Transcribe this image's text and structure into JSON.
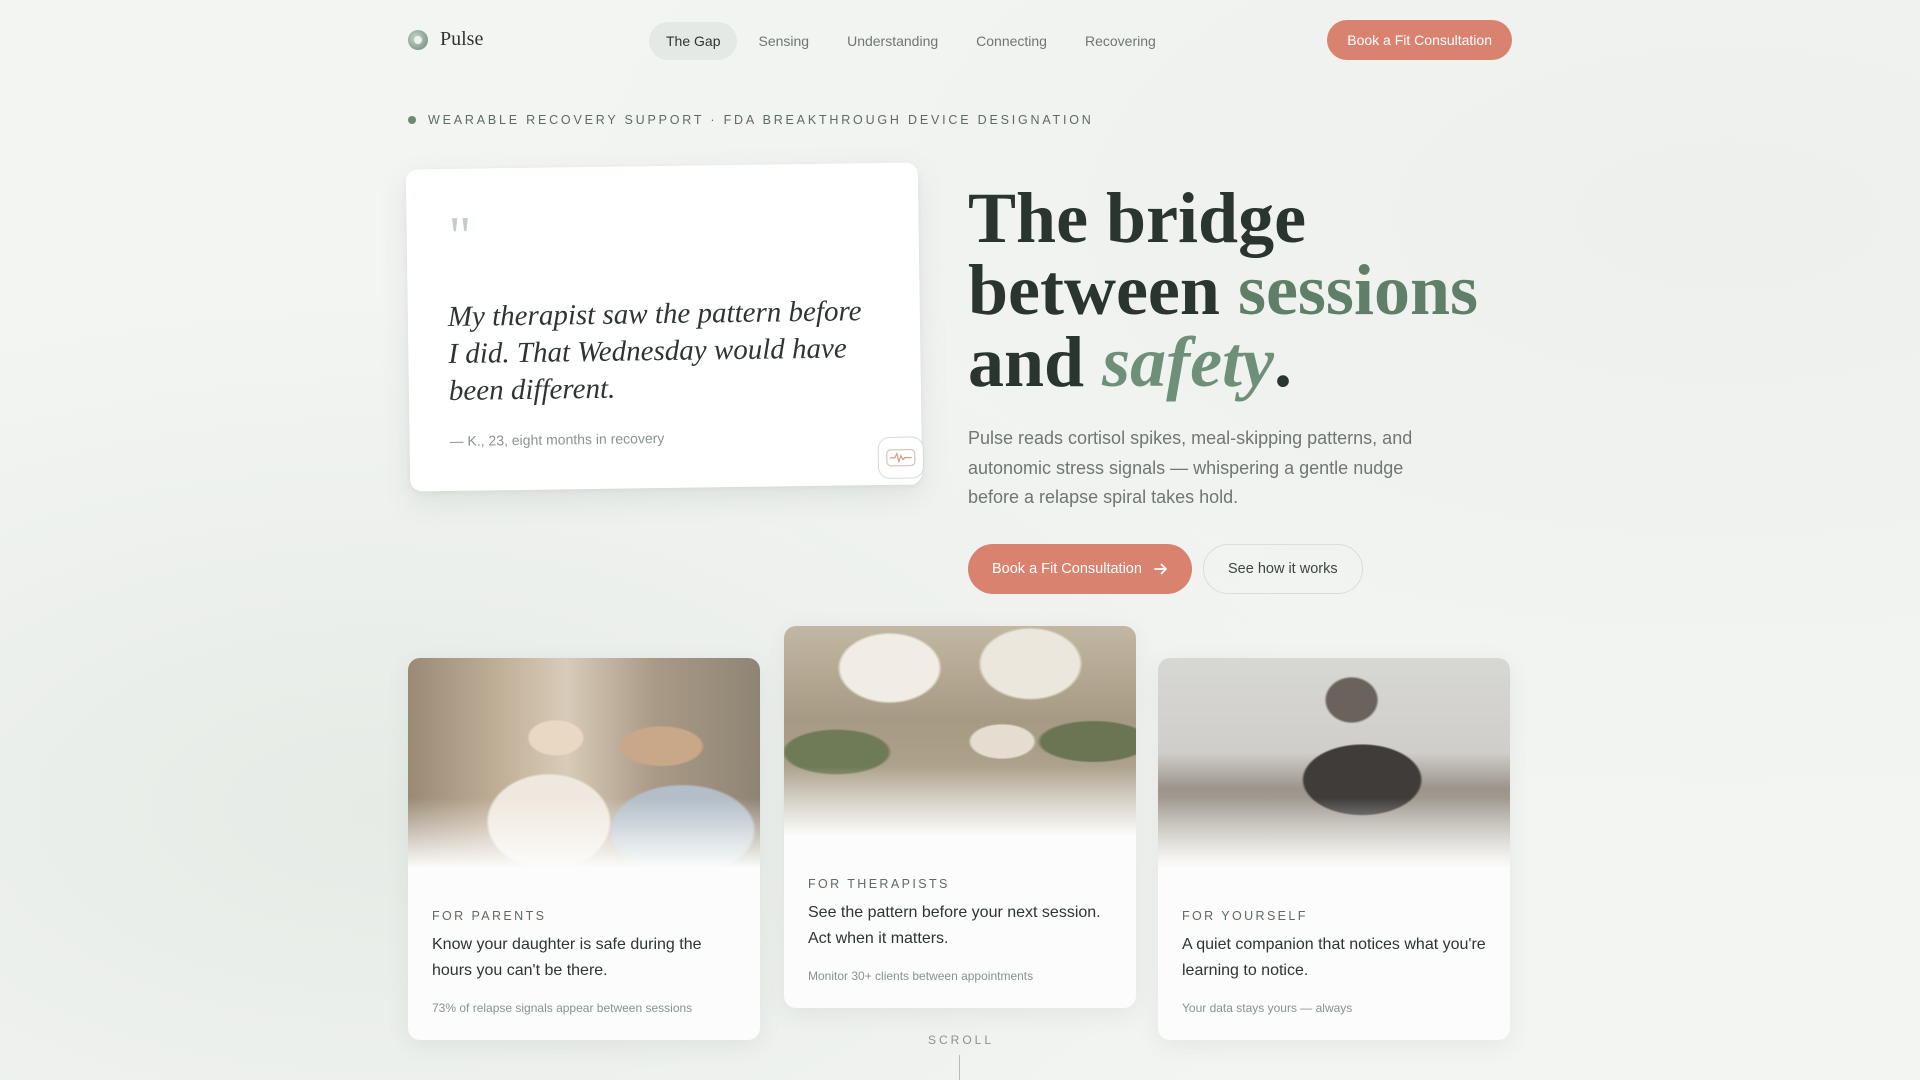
{
  "brand": {
    "name": "Pulse",
    "icon": "leaf-logo-icon"
  },
  "nav": {
    "items": [
      {
        "label": "The Gap",
        "active": true
      },
      {
        "label": "Sensing",
        "active": false
      },
      {
        "label": "Understanding",
        "active": false
      },
      {
        "label": "Connecting",
        "active": false
      },
      {
        "label": "Recovering",
        "active": false
      }
    ],
    "cta_label": "Book a Fit Consultation"
  },
  "eyebrow": "WEARABLE RECOVERY SUPPORT · FDA BREAKTHROUGH DEVICE DESIGNATION",
  "quote": {
    "mark": "\"",
    "text": "My therapist saw the pattern before I did. That Wednesday would have been different.",
    "attribution": "— K., 23, eight months in recovery",
    "badge_icon": "heartbeat-wave-icon"
  },
  "hero": {
    "headline_line1": "The bridge",
    "headline_line2_plain": "between",
    "headline_line2_accent": "sessions",
    "headline_line3_plain": "and",
    "headline_line3_accent": "safety",
    "headline_line3_end": ".",
    "lede": "Pulse reads cortisol spikes, meal-skipping patterns, and autonomic stress signals — whispering a gentle nudge before a relapse spiral takes hold.",
    "primary_cta": "Book a Fit Consultation",
    "secondary_cta": "See how it works"
  },
  "cards": [
    {
      "tag": "FOR PARENTS",
      "body": "Know your daughter is safe during the hours you can't be there.",
      "foot": "73% of relapse signals appear between sessions"
    },
    {
      "tag": "FOR THERAPISTS",
      "body": "See the pattern before your next session. Act when it matters.",
      "foot": "Monitor 30+ clients between appointments"
    },
    {
      "tag": "FOR YOURSELF",
      "body": "A quiet companion that notices what you're learning to notice.",
      "foot": "Your data stays yours — always"
    }
  ],
  "scroll_label": "SCROLL",
  "colors": {
    "accent": "#d9826f",
    "sage": "#5f7f68",
    "ink": "#2e3530"
  }
}
